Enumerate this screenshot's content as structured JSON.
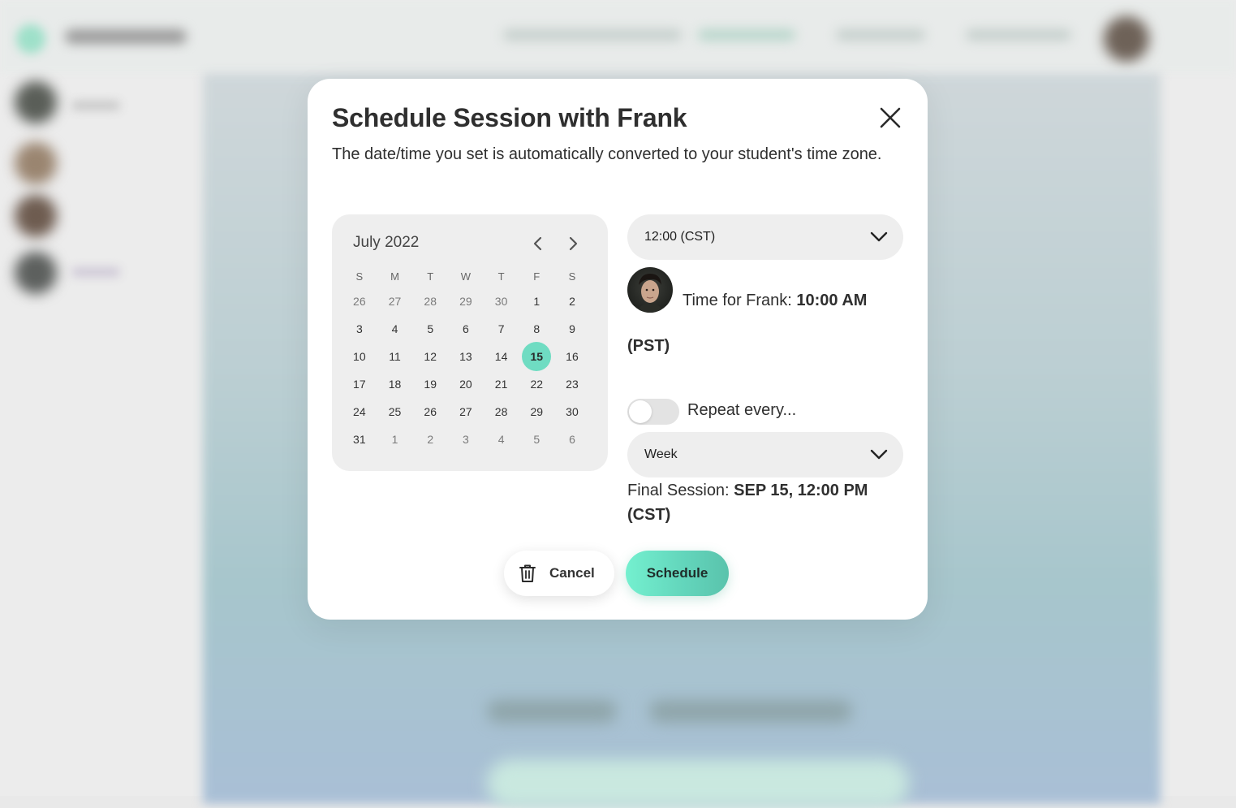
{
  "modal": {
    "title": "Schedule Session with Frank",
    "subtitle": "The date/time you set is automatically converted to your student's time zone."
  },
  "calendar": {
    "month_label": "July 2022",
    "weekdays": [
      "S",
      "M",
      "T",
      "W",
      "T",
      "F",
      "S"
    ],
    "selected_day": "15",
    "weeks": [
      [
        {
          "d": "26",
          "m": true
        },
        {
          "d": "27",
          "m": true
        },
        {
          "d": "28",
          "m": true
        },
        {
          "d": "29",
          "m": true
        },
        {
          "d": "30",
          "m": true
        },
        {
          "d": "1",
          "m": false
        },
        {
          "d": "2",
          "m": false
        }
      ],
      [
        {
          "d": "3",
          "m": false
        },
        {
          "d": "4",
          "m": false
        },
        {
          "d": "5",
          "m": false
        },
        {
          "d": "6",
          "m": false
        },
        {
          "d": "7",
          "m": false
        },
        {
          "d": "8",
          "m": false
        },
        {
          "d": "9",
          "m": false
        }
      ],
      [
        {
          "d": "10",
          "m": false
        },
        {
          "d": "11",
          "m": false
        },
        {
          "d": "12",
          "m": false
        },
        {
          "d": "13",
          "m": false
        },
        {
          "d": "14",
          "m": false
        },
        {
          "d": "15",
          "m": false,
          "selected": true
        },
        {
          "d": "16",
          "m": false
        }
      ],
      [
        {
          "d": "17",
          "m": false
        },
        {
          "d": "18",
          "m": false
        },
        {
          "d": "19",
          "m": false
        },
        {
          "d": "20",
          "m": false
        },
        {
          "d": "21",
          "m": false
        },
        {
          "d": "22",
          "m": false
        },
        {
          "d": "23",
          "m": false
        }
      ],
      [
        {
          "d": "24",
          "m": false
        },
        {
          "d": "25",
          "m": false
        },
        {
          "d": "26",
          "m": false
        },
        {
          "d": "27",
          "m": false
        },
        {
          "d": "28",
          "m": false
        },
        {
          "d": "29",
          "m": false
        },
        {
          "d": "30",
          "m": false
        }
      ],
      [
        {
          "d": "31",
          "m": false
        },
        {
          "d": "1",
          "m": true
        },
        {
          "d": "2",
          "m": true
        },
        {
          "d": "3",
          "m": true
        },
        {
          "d": "4",
          "m": true
        },
        {
          "d": "5",
          "m": true
        },
        {
          "d": "6",
          "m": true
        }
      ]
    ]
  },
  "time_select": {
    "value": "12:00 (CST)"
  },
  "student_time": {
    "prefix": "Time for Frank: ",
    "value": "10:00 AM (PST)"
  },
  "repeat": {
    "label": "Repeat every...",
    "enabled": false,
    "interval_value": "Week"
  },
  "final_session": {
    "prefix": "Final Session: ",
    "value": "SEP 15, 12:00 PM (CST)"
  },
  "buttons": {
    "cancel": "Cancel",
    "schedule": "Schedule"
  },
  "colors": {
    "accent": "#6fdcc2",
    "schedule_gradient_start": "#74f0cf",
    "schedule_gradient_end": "#5ac3ac"
  },
  "icons": {
    "close": "close-icon",
    "prev": "chevron-left-icon",
    "next": "chevron-right-icon",
    "dropdown": "chevron-down-icon",
    "trash": "trash-icon"
  }
}
